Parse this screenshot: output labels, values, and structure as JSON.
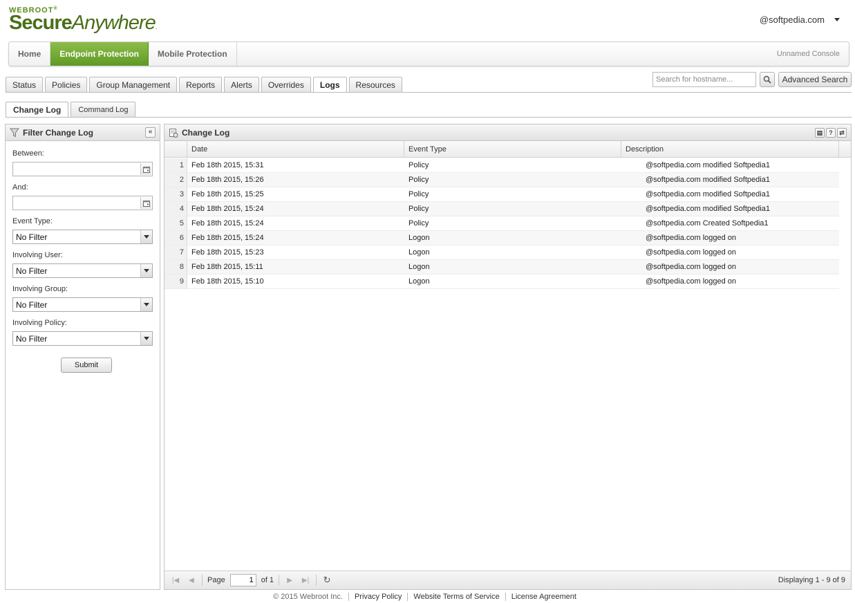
{
  "header": {
    "logo_small": "WEBROOT",
    "logo_reg": "®",
    "logo_secure": "Secure",
    "logo_anywhere": "Anywhere",
    "logo_tm": ".",
    "user": "@softpedia.com"
  },
  "topnav": {
    "items": [
      "Home",
      "Endpoint Protection",
      "Mobile Protection"
    ],
    "active": "Endpoint Protection",
    "console": "Unnamed Console"
  },
  "subtabs": [
    "Status",
    "Policies",
    "Group Management",
    "Reports",
    "Alerts",
    "Overrides",
    "Logs",
    "Resources"
  ],
  "active_subtab": "Logs",
  "search": {
    "placeholder": "Search for hostname...",
    "advanced": "Advanced Search"
  },
  "logtabs": [
    "Change Log",
    "Command Log"
  ],
  "filter": {
    "title": "Filter Change Log",
    "collapse": "«",
    "between": "Between:",
    "and": "And:",
    "event_type": "Event Type:",
    "involving_user": "Involving User:",
    "involving_group": "Involving Group:",
    "involving_policy": "Involving Policy:",
    "no_filter": "No Filter",
    "submit": "Submit"
  },
  "log": {
    "title": "Change Log",
    "columns": [
      "Date",
      "Event Type",
      "Description"
    ],
    "rows": [
      {
        "n": "1",
        "date": "Feb 18th 2015, 15:31",
        "type": "Policy",
        "desc": "@softpedia.com modified Softpedia1"
      },
      {
        "n": "2",
        "date": "Feb 18th 2015, 15:26",
        "type": "Policy",
        "desc": "@softpedia.com modified Softpedia1"
      },
      {
        "n": "3",
        "date": "Feb 18th 2015, 15:25",
        "type": "Policy",
        "desc": "@softpedia.com modified Softpedia1"
      },
      {
        "n": "4",
        "date": "Feb 18th 2015, 15:24",
        "type": "Policy",
        "desc": "@softpedia.com modified Softpedia1"
      },
      {
        "n": "5",
        "date": "Feb 18th 2015, 15:24",
        "type": "Policy",
        "desc": "@softpedia.com Created Softpedia1"
      },
      {
        "n": "6",
        "date": "Feb 18th 2015, 15:24",
        "type": "Logon",
        "desc": "@softpedia.com logged on"
      },
      {
        "n": "7",
        "date": "Feb 18th 2015, 15:23",
        "type": "Logon",
        "desc": "@softpedia.com logged on"
      },
      {
        "n": "8",
        "date": "Feb 18th 2015, 15:11",
        "type": "Logon",
        "desc": "@softpedia.com logged on"
      },
      {
        "n": "9",
        "date": "Feb 18th 2015, 15:10",
        "type": "Logon",
        "desc": "@softpedia.com logged on"
      }
    ],
    "pager": {
      "page_label": "Page",
      "page": "1",
      "of": "of 1",
      "displaying": "Displaying 1 - 9 of 9"
    }
  },
  "footer": {
    "copyright": "© 2015 Webroot Inc.",
    "links": [
      "Privacy Policy",
      "Website Terms of Service",
      "License Agreement"
    ]
  },
  "colors": {
    "accent": "#6ea530",
    "brand_text": "#4a6f17"
  }
}
